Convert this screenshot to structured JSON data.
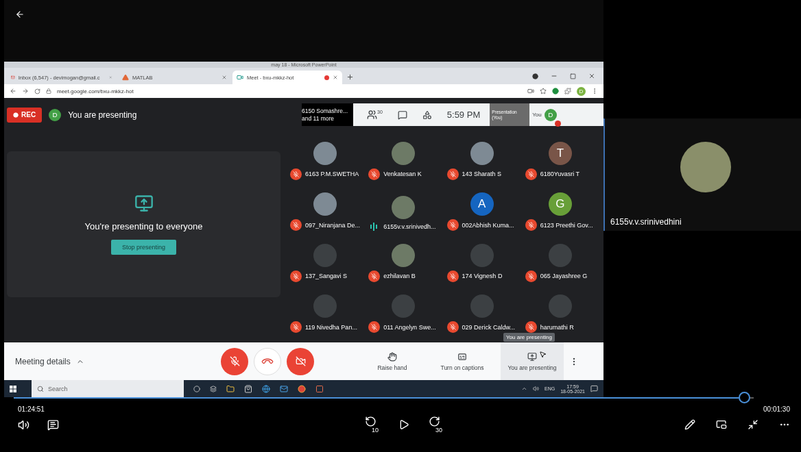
{
  "powerpoint_title": "may 18 - Microsoft PowerPoint",
  "browser": {
    "tabs": [
      {
        "title": "Inbox (6,547) - devimogan@gmail.c",
        "kind": "mail",
        "selected": false,
        "recording": false
      },
      {
        "title": "MATLAB",
        "kind": "matlab",
        "selected": false,
        "recording": false
      },
      {
        "title": "Meet - bxu-mkkz-hot",
        "kind": "meet",
        "selected": true,
        "recording": true
      }
    ],
    "url": "meet.google.com/bxu-mkkz-hot",
    "profile": "D"
  },
  "meet": {
    "rec": "REC",
    "user_initial": "D",
    "status": "You are presenting",
    "pinned_line1": "6150 Somashre...",
    "pinned_line2": "and 11 more",
    "people_count": "30",
    "time": "5:59 PM",
    "presentation_thumb": "Presentation (You)",
    "self_label": "You",
    "self_initial": "D",
    "presenting_panel": {
      "message": "You're presenting to everyone",
      "button": "Stop presenting"
    },
    "participants": [
      {
        "name": "6163 P.M.SWETHA",
        "muted": true,
        "kind": "photo"
      },
      {
        "name": "Venkatesan K",
        "muted": true,
        "kind": "photo"
      },
      {
        "name": "143 Sharath S",
        "muted": true,
        "kind": "photo"
      },
      {
        "name": "6180Yuvasri T",
        "muted": true,
        "kind": "letter",
        "letter": "T",
        "color": "#795548"
      },
      {
        "name": "097_Niranjana De...",
        "muted": true,
        "kind": "photo"
      },
      {
        "name": "6155v.v.srinivedh...",
        "muted": false,
        "kind": "photo"
      },
      {
        "name": "002Abhish Kuma...",
        "muted": true,
        "kind": "letter",
        "letter": "A",
        "color": "#1565c0"
      },
      {
        "name": "6123 Preethi Gov...",
        "muted": true,
        "kind": "letter",
        "letter": "G",
        "color": "#689f38"
      },
      {
        "name": "137_Sangavi S",
        "muted": true,
        "kind": "blank"
      },
      {
        "name": "ezhilavan B",
        "muted": true,
        "kind": "photo"
      },
      {
        "name": "174 Vignesh D",
        "muted": true,
        "kind": "blank"
      },
      {
        "name": "065 Jayashree G",
        "muted": true,
        "kind": "blank"
      },
      {
        "name": "119 Nivedha Pan...",
        "muted": true,
        "kind": "blank"
      },
      {
        "name": "011 Angelyn Swe...",
        "muted": true,
        "kind": "blank"
      },
      {
        "name": "029 Derick Caldw...",
        "muted": true,
        "kind": "blank"
      },
      {
        "name": "harumathi R",
        "muted": true,
        "kind": "blank"
      }
    ],
    "meeting_details": "Meeting details",
    "actions": [
      {
        "kind": "raise",
        "label": "Raise hand",
        "selected": false
      },
      {
        "kind": "captions",
        "label": "Turn on captions",
        "selected": false
      },
      {
        "kind": "present",
        "label": "You are presenting",
        "selected": true
      }
    ],
    "tooltip": "You are presenting"
  },
  "taskbar": {
    "search_placeholder": "Search",
    "language": "ENG",
    "time": "17:59",
    "date": "18-05-2021"
  },
  "side_tile": {
    "name": "6155v.v.srinivedhini"
  },
  "playback": {
    "level": 0.98,
    "elapsed": "01:24:51",
    "remaining": "00:01:30",
    "skip_back": "10",
    "skip_forward": "30"
  }
}
